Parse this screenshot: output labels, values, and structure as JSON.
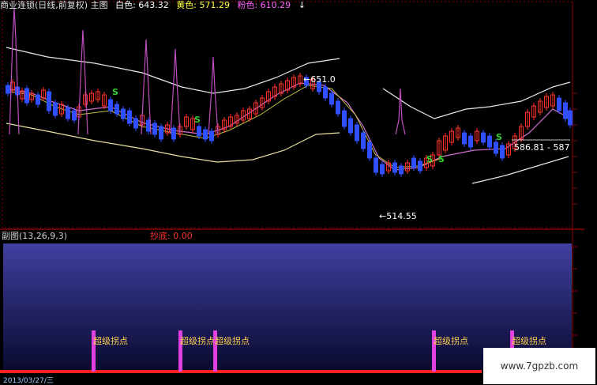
{
  "header": {
    "title": "商业连锁(日线,前复权) 主图",
    "white_label": "白色: 643.32",
    "yellow_label": "黄色: 571.29",
    "pink_label": "粉色: 610.29",
    "arrow": "↓"
  },
  "sub_panel": {
    "title": "副图(13,26,9,3)",
    "indicator_label": "抄底: 0.00",
    "signal_text": "超级拐点"
  },
  "watermark": "www.7gpzb.com",
  "date_partial": "2013/03/27/三",
  "colors": {
    "white_line": "#e8e8e8",
    "yellow_line": "#e8e0a0",
    "pink_line": "#d070d0",
    "up_candle": "#ff3030",
    "down_candle": "#3050ff",
    "spike": "#c050c0",
    "s_signal": "#30d030",
    "grid": "#8a0000",
    "sub_bar": "#e040e0"
  },
  "chart_data": [
    {
      "type": "line",
      "title": "商业连锁(日线,前复权) 主图",
      "series": [
        {
          "name": "白色",
          "last": 643.32
        },
        {
          "name": "黄色",
          "last": 571.29
        },
        {
          "name": "粉色",
          "last": 610.29
        }
      ],
      "annotations": [
        {
          "text": "651.0",
          "value": 651.0
        },
        {
          "text": "514.55",
          "value": 514.55
        },
        {
          "text": "586.81 - 587",
          "value": 586.81
        }
      ],
      "signals": [
        "S",
        "S",
        "S",
        "S",
        "S"
      ]
    },
    {
      "type": "bar",
      "title": "副图(13,26,9,3)",
      "series": [
        {
          "name": "抄底",
          "last": 0.0
        }
      ],
      "labels": [
        "超级拐点",
        "超级拐点",
        "超级拐点",
        "超级拐点",
        "超级拐点"
      ]
    }
  ]
}
